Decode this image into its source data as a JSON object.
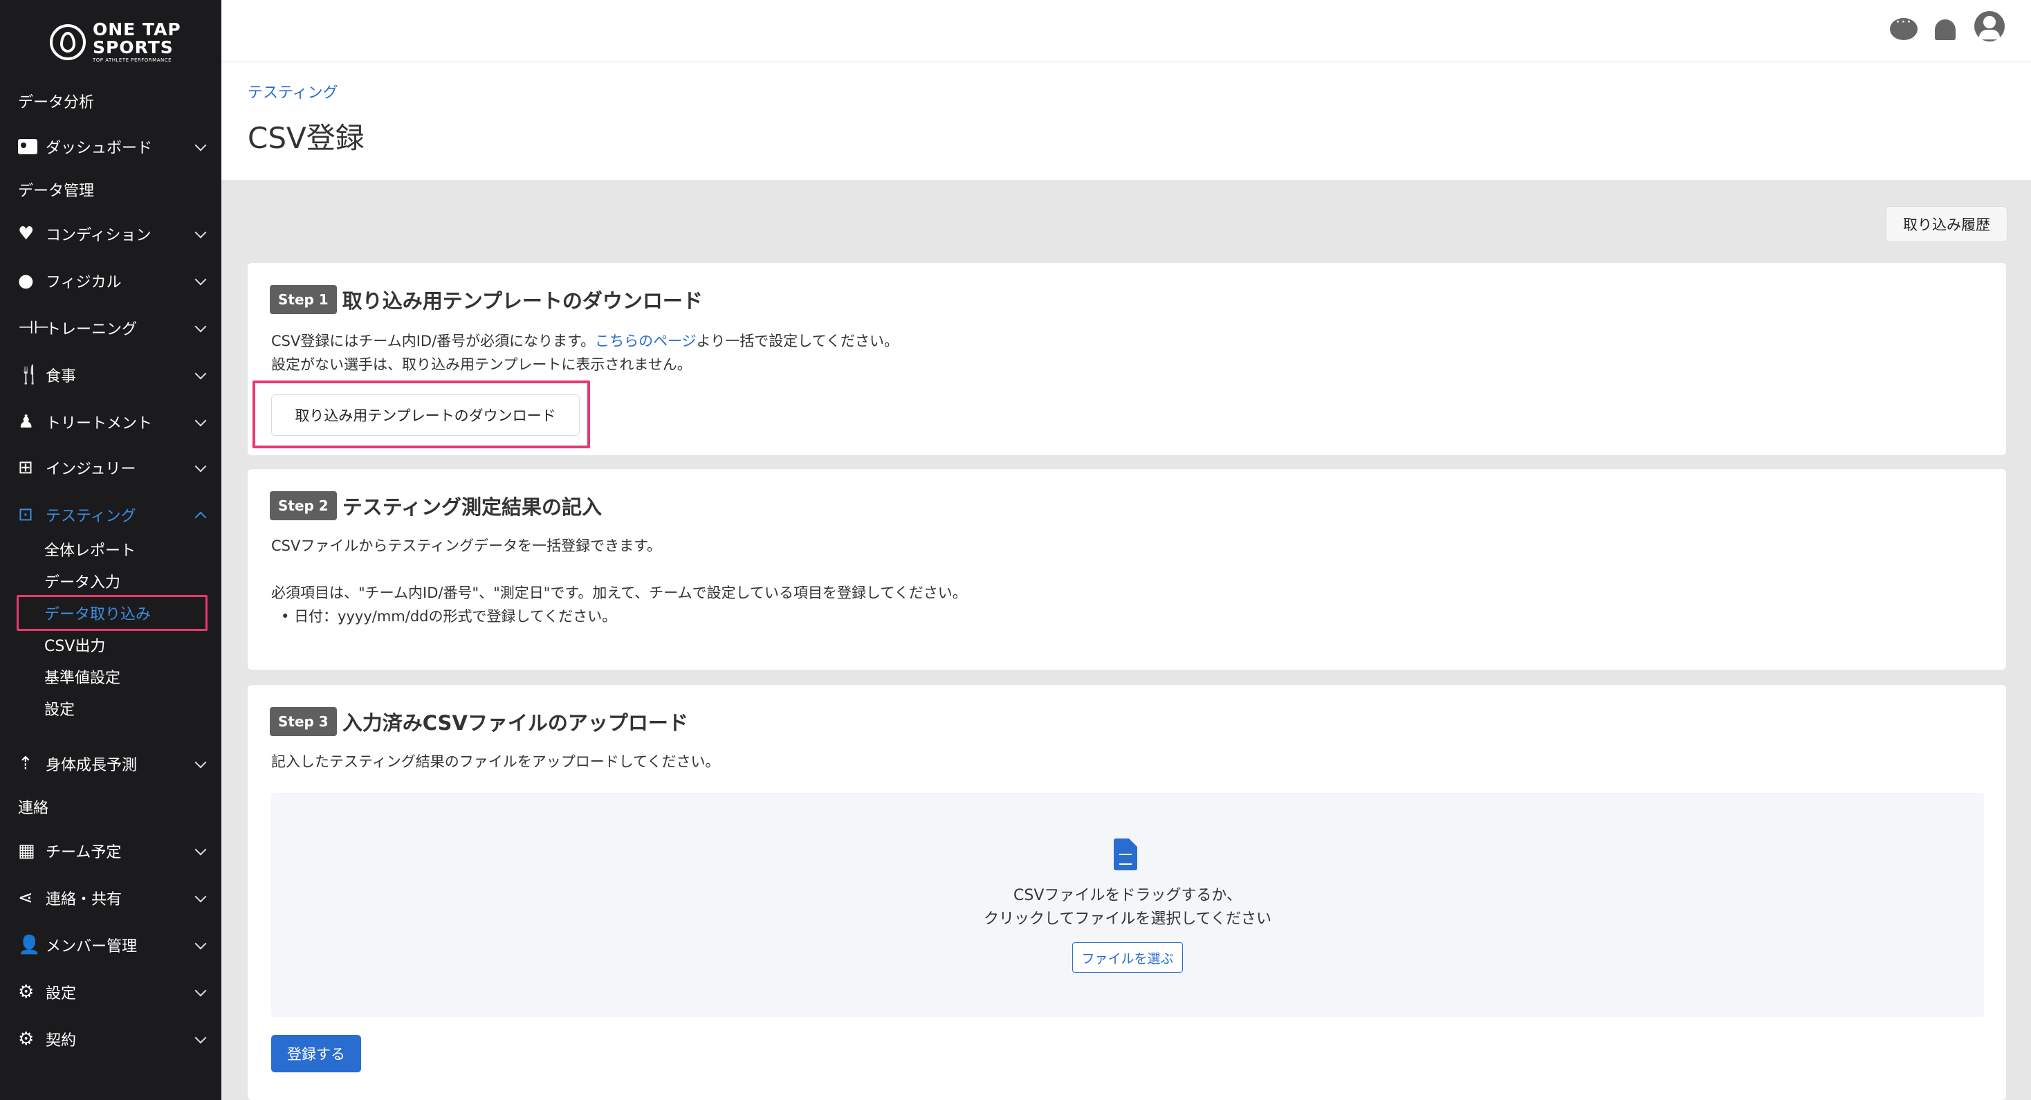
{
  "brand": {
    "line1": "ONE TAP",
    "line2": "SPORTS",
    "line3": "TOP ATHLETE PERFORMANCE"
  },
  "sidebar": {
    "section_data_analysis": "データ分析",
    "dashboard": "ダッシュボード",
    "section_data_management": "データ管理",
    "condition": "コンディション",
    "physical": "フィジカル",
    "training": "トレーニング",
    "meal": "食事",
    "treatment": "トリートメント",
    "injury": "インジュリー",
    "testing": "テスティング",
    "testing_sub": [
      "全体レポート",
      "データ入力",
      "データ取り込み",
      "CSV出力",
      "基準値設定",
      "設定"
    ],
    "growth": "身体成長予測",
    "section_contact": "連絡",
    "schedule": "チーム予定",
    "share": "連絡・共有",
    "members": "メンバー管理",
    "settings": "設定",
    "contract": "契約"
  },
  "header": {
    "breadcrumb": "テスティング",
    "title": "CSV登録"
  },
  "history_button": "取り込み履歴",
  "step1": {
    "badge": "Step 1",
    "title": "取り込み用テンプレートのダウンロード",
    "text1_pre": "CSV登録にはチーム内ID/番号が必須になります。",
    "text1_link": "こちらのページ",
    "text1_post": "より一括で設定してください。",
    "text2": "設定がない選手は、取り込み用テンプレートに表示されません。",
    "download_button": "取り込み用テンプレートのダウンロード"
  },
  "step2": {
    "badge": "Step 2",
    "title": "テスティング測定結果の記入",
    "text1": "CSVファイルからテスティングデータを一括登録できます。",
    "text2": "必須項目は、\"チーム内ID/番号\"、\"測定日\"です。加えて、チームで設定している項目を登録してください。",
    "bullet": "日付：yyyy/mm/ddの形式で登録してください。"
  },
  "step3": {
    "badge": "Step 3",
    "title": "入力済みCSVファイルのアップロード",
    "text1": "記入したテスティング結果のファイルをアップロードしてください。",
    "drop_line1": "CSVファイルをドラッグするか、",
    "drop_line2": "クリックしてファイルを選択してください",
    "choose_button": "ファイルを選ぶ",
    "register_button": "登録する"
  }
}
